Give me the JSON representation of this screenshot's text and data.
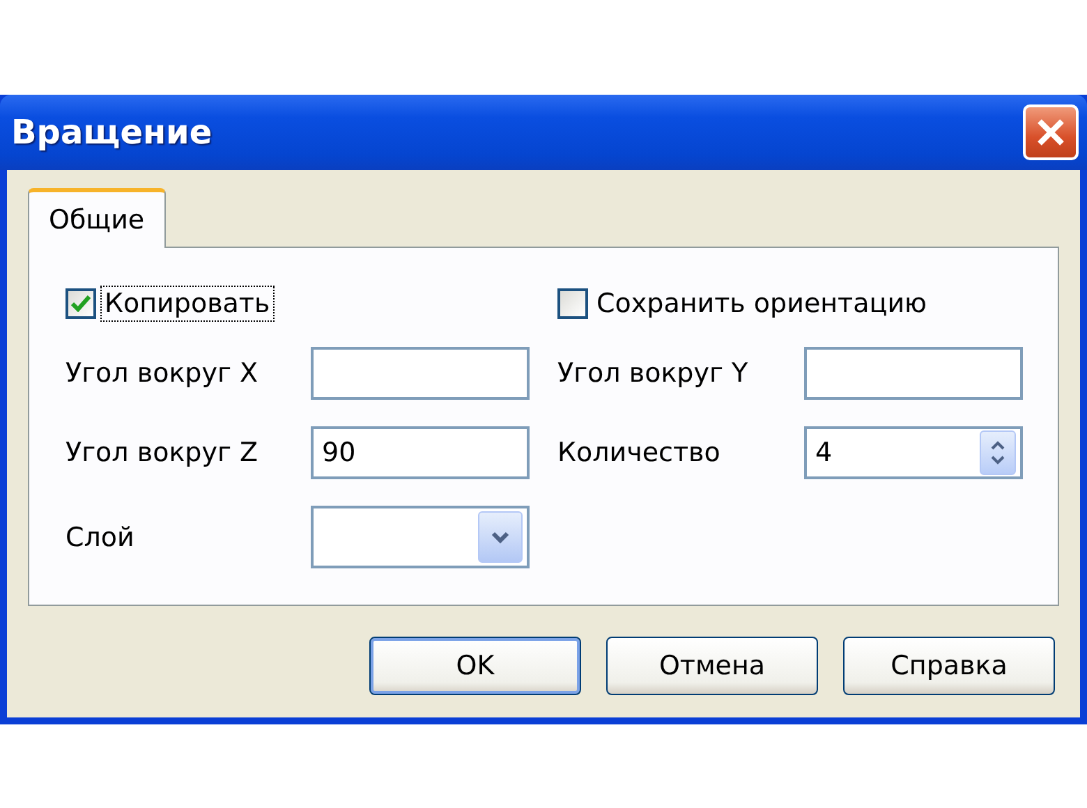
{
  "window": {
    "title": "Вращение"
  },
  "tabs": [
    {
      "label": "Общие",
      "selected": true
    }
  ],
  "checkboxes": [
    {
      "label": "Копировать",
      "checked": true,
      "focused": true
    },
    {
      "label": "Сохранить ориентацию",
      "checked": false,
      "focused": false
    }
  ],
  "fields": [
    {
      "label": "Угол вокруг X",
      "kind": "text"
    },
    {
      "label": "Угол вокруг Y",
      "kind": "text"
    },
    {
      "label": "Угол вокруг Z",
      "kind": "text",
      "value": "90"
    },
    {
      "label": "Количество",
      "kind": "spin",
      "value": "4"
    },
    {
      "label": "Слой",
      "kind": "combo"
    }
  ],
  "buttons": [
    {
      "label": "OK",
      "default": true
    },
    {
      "label": "Отмена",
      "default": false
    },
    {
      "label": "Справка",
      "default": false
    }
  ]
}
